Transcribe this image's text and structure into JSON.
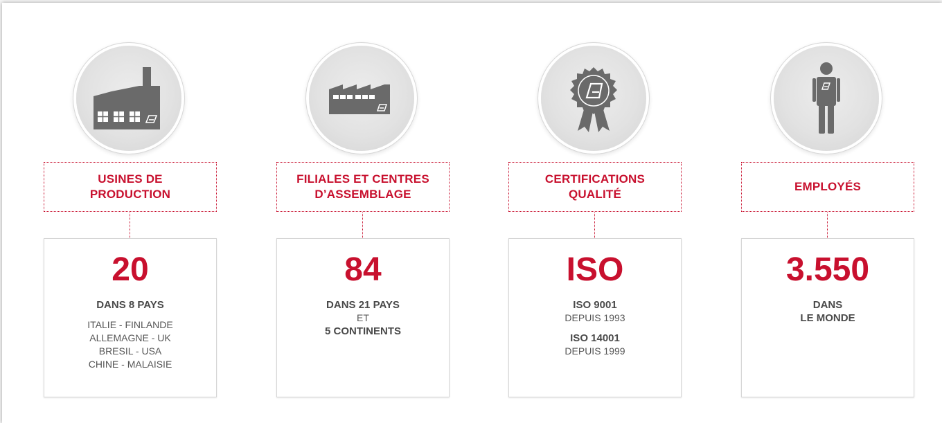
{
  "colors": {
    "accent": "#c8102e",
    "icon": "#6a6a6a",
    "text": "#4a4a4a"
  },
  "columns": [
    {
      "icon": "factory-icon",
      "title_line1": "USINES DE",
      "title_line2": "PRODUCTION",
      "value": "20",
      "subtitle": "DANS 8 PAYS",
      "details": [
        "ITALIE - FINLANDE",
        "ALLEMAGNE - UK",
        "BRESIL - USA",
        "CHINE - MALAISIE"
      ]
    },
    {
      "icon": "assembly-plant-icon",
      "title_line1": "FILIALES ET CENTRES",
      "title_line2": "D’ASSEMBLAGE",
      "value": "84",
      "line1": "DANS 21 PAYS",
      "line2": "ET",
      "line3": "5 CONTINENTS"
    },
    {
      "icon": "certification-badge-icon",
      "title_line1": "CERTIFICATIONS",
      "title_line2": "QUALITÉ",
      "value": "ISO",
      "cert1_name": "ISO 9001",
      "cert1_since": "DEPUIS 1993",
      "cert2_name": "ISO 14001",
      "cert2_since": "DEPUIS 1999"
    },
    {
      "icon": "employee-icon",
      "title_line1": "EMPLOYÉS",
      "value": "3.550",
      "line1": "DANS",
      "line2": "LE MONDE"
    }
  ]
}
